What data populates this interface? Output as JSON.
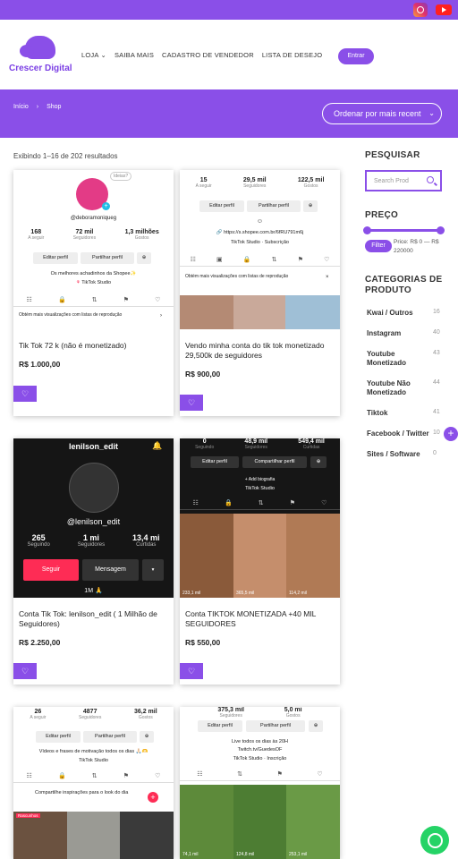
{
  "topbar": {
    "instagram_icon": "instagram-icon",
    "youtube_icon": "youtube-icon"
  },
  "header": {
    "logo_text": "Crescer Digital",
    "nav": [
      "LOJA",
      "SAIBA MAIS",
      "CADASTRO DE VENDEDOR",
      "LISTA DE DESEJO"
    ],
    "login_label": "Entrar"
  },
  "banner": {
    "crumbs": [
      "Início",
      "Shop"
    ],
    "order_label": "Ordenar por mais recent"
  },
  "results_text": "Exibindo 1–16 de 202 resultados",
  "products": [
    {
      "title": "Tik Tok 72 k (não é monetizado)",
      "price": "R$ 1.000,00",
      "shot": {
        "bubble": "Ideias?",
        "handle": "@deboramoniqueg",
        "stats": [
          {
            "v": "168",
            "l": "A seguir"
          },
          {
            "v": "72 mil",
            "l": "Seguidores"
          },
          {
            "v": "1,3 milhões",
            "l": "Gostos"
          }
        ],
        "buttons": [
          "Editar perfil",
          "Partilhar perfil"
        ],
        "bio": "Os melhores achadinhos da Shopee✨",
        "studio": "TikTok Studio",
        "banner_text": "Obtém mais visualizações com listas de reprodução"
      }
    },
    {
      "title": "Vendo minha conta do tik tok monetizado 29,500k de seguidores",
      "price": "R$ 900,00",
      "shot": {
        "stats": [
          {
            "v": "15",
            "l": "A seguir"
          },
          {
            "v": "29,5 mil",
            "l": "Seguidores"
          },
          {
            "v": "122,5 mil",
            "l": "Gostos"
          }
        ],
        "buttons": [
          "Editar perfil",
          "Partilhar perfil"
        ],
        "link": "https://s.shopee.com.br/6fRU791m6j",
        "studio": "TikTok Studio",
        "subscription": "Subscrição",
        "banner_text": "Obtém mais visualizações com listas de reprodução"
      }
    },
    {
      "title": "Conta Tik Tok: lenilson_edit ( 1 Milhão de Seguidores)",
      "price": "R$ 2.250,00",
      "shot": {
        "name": "lenilson_edit",
        "handle": "@lenilson_edit",
        "stats": [
          {
            "v": "265",
            "l": "Seguindo"
          },
          {
            "v": "1 mi",
            "l": "Seguidores"
          },
          {
            "v": "13,4 mi",
            "l": "Curtidas"
          }
        ],
        "follow": "Seguir",
        "message": "Mensagem",
        "footer": "1M 🙏"
      }
    },
    {
      "title": "Conta TIKTOK MONETIZADA +40 MIL SEGUIDORES",
      "price": "R$ 550,00",
      "shot": {
        "stats": [
          {
            "v": "0",
            "l": "Seguindo"
          },
          {
            "v": "48,9 mil",
            "l": "Seguidores"
          },
          {
            "v": "549,4 mil",
            "l": "Curtidas"
          }
        ],
        "buttons": [
          "Editar perfil",
          "Compartilhar perfil"
        ],
        "bio_add": "+ Add biografia",
        "studio": "TikTok Studio",
        "views": [
          "233,1 mil",
          "365,5 mil",
          "114,2 mil"
        ]
      }
    },
    {
      "title": "",
      "price": "",
      "shot": {
        "stats": [
          {
            "v": "26",
            "l": "A seguir"
          },
          {
            "v": "4877",
            "l": "Seguidores"
          },
          {
            "v": "36,2 mil",
            "l": "Gostos"
          }
        ],
        "buttons": [
          "Editar perfil",
          "Partilhar perfil"
        ],
        "bio": "Vídeos e frases de motivação todos os dias 🙏🏻🫶",
        "studio": "TikTok Studio",
        "banner_text": "Compartilhe inspirações para o look do dia",
        "tag": "Rascunhos"
      }
    },
    {
      "title": "",
      "price": "",
      "shot": {
        "stats": [
          {
            "v": "375,3 mil",
            "l": "Seguidores"
          },
          {
            "v": "5,0 mi",
            "l": "Gostos"
          }
        ],
        "buttons": [
          "Editar perfil",
          "Partilhar perfil"
        ],
        "live": "Live todos os dias às 20H",
        "link": "Twitch.tv/GuedesOF",
        "studio": "TikTok Studio",
        "subscription": "Inscrição",
        "views": [
          "74,1 mil",
          "124,8 mil",
          "253,1 mil"
        ]
      }
    }
  ],
  "sidebar": {
    "search_title": "PESQUISAR",
    "search_placeholder": "Search Prod",
    "price_title": "PREÇO",
    "filter_label": "Filter",
    "price_range": "Price: R$ 0 — R$ 220000",
    "categories_title": "CATEGORIAS DE PRODUTO",
    "categories": [
      {
        "name": "Kwai / Outros",
        "count": "16"
      },
      {
        "name": "Instagram",
        "count": "40"
      },
      {
        "name": "Youtube Monetizado",
        "count": "43"
      },
      {
        "name": "Youtube Não Monetizado",
        "count": "44"
      },
      {
        "name": "Tiktok",
        "count": "41"
      },
      {
        "name": "Facebook / Twitter",
        "count": "10"
      },
      {
        "name": "Sites / Software",
        "count": "0"
      }
    ]
  },
  "colors": {
    "accent": "#8a4fe8",
    "whatsapp": "#25d366",
    "tiktok_red": "#fe2c55"
  }
}
